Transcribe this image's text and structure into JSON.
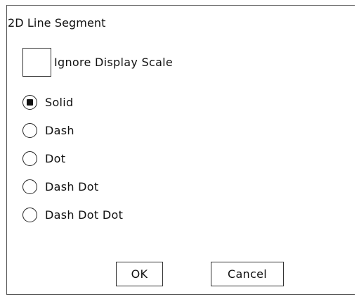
{
  "dialog": {
    "title": "2D Line Segment",
    "ignore_display_scale": {
      "label": "Ignore Display Scale",
      "checked": false
    },
    "line_styles": [
      {
        "label": "Solid",
        "selected": true
      },
      {
        "label": "Dash",
        "selected": false
      },
      {
        "label": "Dot",
        "selected": false
      },
      {
        "label": "Dash Dot",
        "selected": false
      },
      {
        "label": "Dash Dot Dot",
        "selected": false
      }
    ],
    "ok_label": "OK",
    "cancel_label": "Cancel"
  }
}
